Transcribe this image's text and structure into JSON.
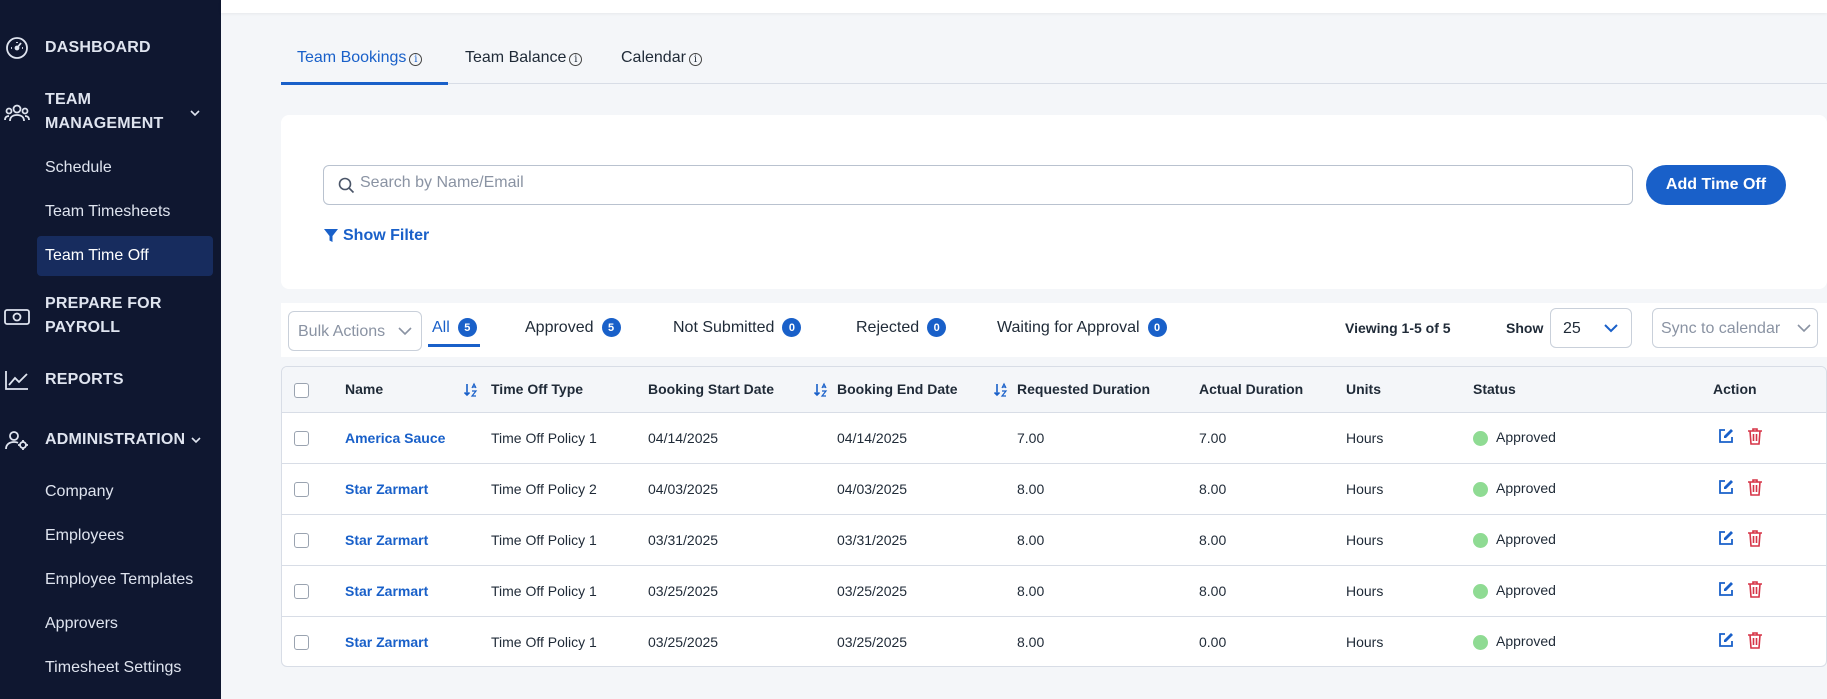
{
  "sidebar": {
    "dashboard": "DASHBOARD",
    "team_management_line1": "TEAM",
    "team_management_line2": "MANAGEMENT",
    "team_items": [
      "Schedule",
      "Team Timesheets"
    ],
    "team_active": "Team Time Off",
    "payroll_line1": "PREPARE FOR",
    "payroll_line2": "PAYROLL",
    "reports": "REPORTS",
    "administration": "ADMINISTRATION",
    "admin_items": [
      "Company",
      "Employees",
      "Employee Templates",
      "Approvers",
      "Timesheet Settings"
    ]
  },
  "tabs": {
    "bookings": "Team Bookings",
    "balance": "Team Balance",
    "calendar": "Calendar",
    "info_glyph": "i"
  },
  "search": {
    "placeholder": "Search by Name/Email",
    "value": "",
    "add_button": "Add Time Off",
    "show_filter": "Show Filter"
  },
  "filters": {
    "bulk_actions": "Bulk Actions",
    "tabs": [
      {
        "label": "All",
        "count": "5"
      },
      {
        "label": "Approved",
        "count": "5"
      },
      {
        "label": "Not Submitted",
        "count": "0"
      },
      {
        "label": "Rejected",
        "count": "0"
      },
      {
        "label": "Waiting for Approval",
        "count": "0"
      }
    ],
    "viewing": "Viewing 1-5 of 5",
    "show_label": "Show",
    "show_value": "25",
    "sync_placeholder": "Sync to calendar"
  },
  "table": {
    "headers": [
      "Name",
      "Time Off Type",
      "Booking Start Date",
      "Booking End Date",
      "Requested Duration",
      "Actual Duration",
      "Units",
      "Status",
      "Action"
    ],
    "rows": [
      {
        "name": "America Sauce",
        "type": "Time Off Policy 1",
        "start": "04/14/2025",
        "end": "04/14/2025",
        "requested": "7.00",
        "actual": "7.00",
        "units": "Hours",
        "status": "Approved"
      },
      {
        "name": "Star Zarmart",
        "type": "Time Off Policy 2",
        "start": "04/03/2025",
        "end": "04/03/2025",
        "requested": "8.00",
        "actual": "8.00",
        "units": "Hours",
        "status": "Approved"
      },
      {
        "name": "Star Zarmart",
        "type": "Time Off Policy 1",
        "start": "03/31/2025",
        "end": "03/31/2025",
        "requested": "8.00",
        "actual": "8.00",
        "units": "Hours",
        "status": "Approved"
      },
      {
        "name": "Star Zarmart",
        "type": "Time Off Policy 1",
        "start": "03/25/2025",
        "end": "03/25/2025",
        "requested": "8.00",
        "actual": "8.00",
        "units": "Hours",
        "status": "Approved"
      },
      {
        "name": "Star Zarmart",
        "type": "Time Off Policy 1",
        "start": "03/25/2025",
        "end": "03/25/2025",
        "requested": "8.00",
        "actual": "0.00",
        "units": "Hours",
        "status": "Approved"
      }
    ]
  },
  "colors": {
    "sidebar_bg": "#0f1730",
    "accent": "#1960c9",
    "status_approved": "#8fdb93",
    "delete": "#d63447"
  },
  "icons": [
    "dashboard-icon",
    "team-icon",
    "payroll-icon",
    "reports-icon",
    "admin-icon",
    "search-icon",
    "filter-icon",
    "sort-icon",
    "edit-icon",
    "delete-icon",
    "chevron-down-icon",
    "info-icon"
  ]
}
